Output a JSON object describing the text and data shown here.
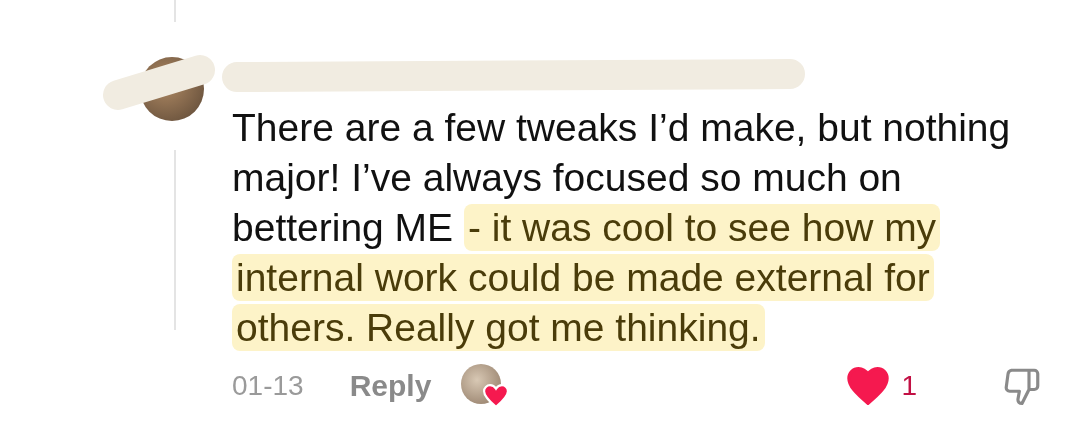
{
  "comment": {
    "text_segments": [
      {
        "text": "There are a few tweaks I’d make, but nothing major! I’ve always focused so much on bettering ME ",
        "highlighted": false
      },
      {
        "text": "- it was cool to see how my internal work could be made external for others. Really got me thinking.",
        "highlighted": true
      }
    ],
    "date": "01-13",
    "reply_label": "Reply",
    "liked_by_creator": true,
    "liked": true,
    "like_count": "1",
    "disliked": false
  }
}
